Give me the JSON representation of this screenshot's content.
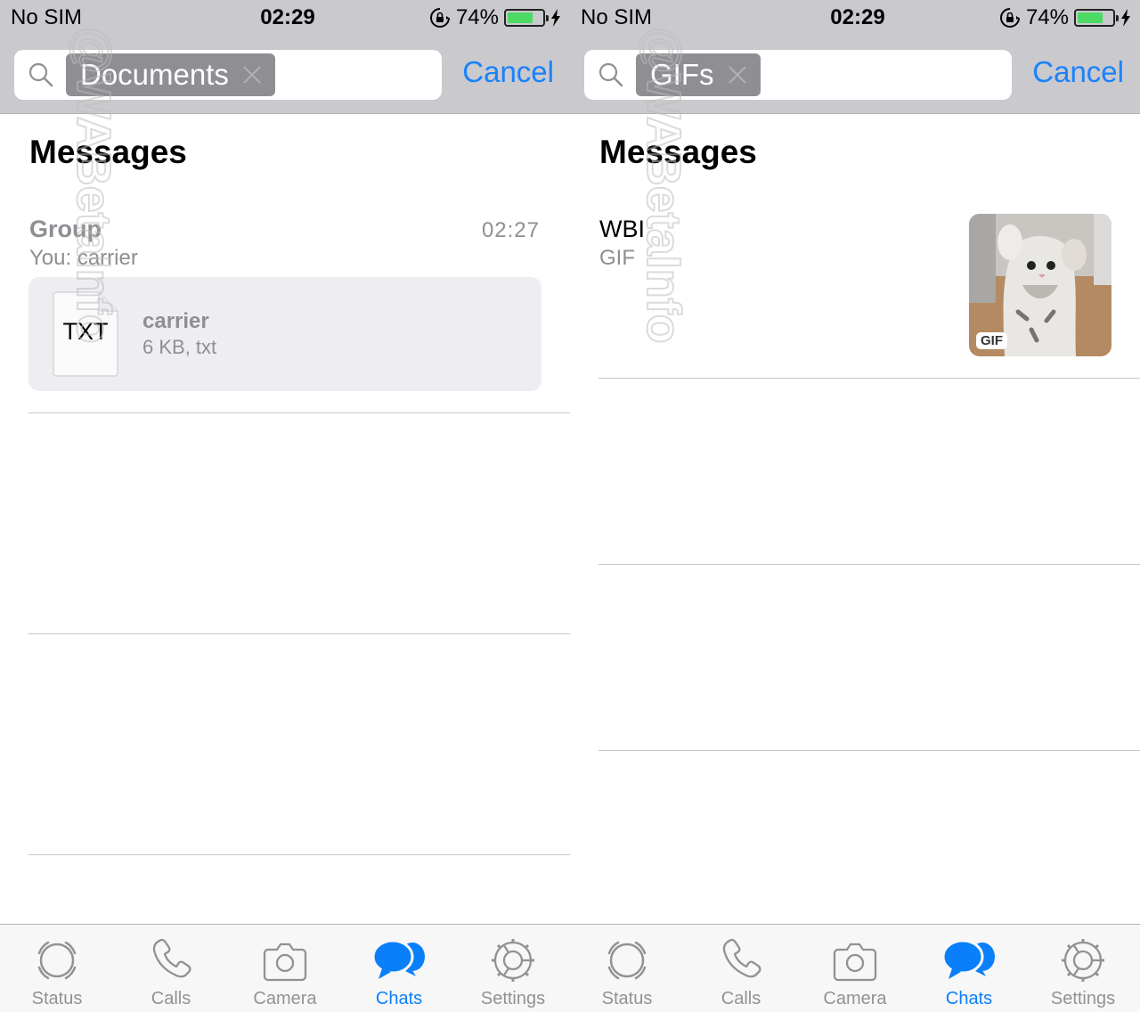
{
  "status_bar": {
    "carrier": "No SIM",
    "time": "02:29",
    "battery_percent_label": "74%",
    "battery_level": 0.74,
    "icons": [
      "orientation-lock-icon",
      "battery-icon",
      "charging-bolt-icon"
    ]
  },
  "watermark": "@WABetaInfo",
  "accent_color": "#1a82fb",
  "tabbar": {
    "items": [
      {
        "label": "Status",
        "icon": "status-icon",
        "active": false
      },
      {
        "label": "Calls",
        "icon": "phone-icon",
        "active": false
      },
      {
        "label": "Camera",
        "icon": "camera-icon",
        "active": false
      },
      {
        "label": "Chats",
        "icon": "chats-icon",
        "active": true
      },
      {
        "label": "Settings",
        "icon": "gear-icon",
        "active": false
      }
    ]
  },
  "left": {
    "search": {
      "token": "Documents",
      "cancel_label": "Cancel"
    },
    "section_title": "Messages",
    "results": [
      {
        "chat_name": "Group",
        "preview": "You: carrier",
        "time": "02:27",
        "attachment": {
          "type_label": "TXT",
          "name": "carrier",
          "meta": "6 KB, txt"
        }
      }
    ]
  },
  "right": {
    "search": {
      "token": "GIFs",
      "cancel_label": "Cancel"
    },
    "section_title": "Messages",
    "results": [
      {
        "chat_name": "WBI",
        "preview": "GIF",
        "thumbnail_badge": "GIF"
      }
    ]
  }
}
